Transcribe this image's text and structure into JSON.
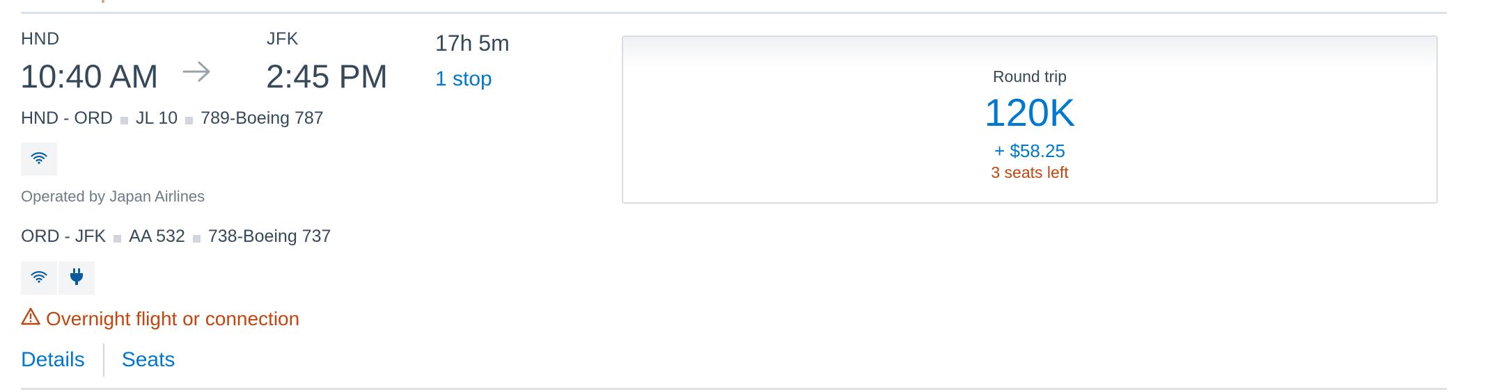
{
  "flight": {
    "depart": {
      "code": "HND",
      "time": "10:40 AM"
    },
    "arrive": {
      "code": "JFK",
      "time": "2:45 PM"
    },
    "arrow_icon": "arrow-right-icon",
    "duration": "17h 5m",
    "stops": "1 stop",
    "segments": [
      {
        "route": "HND - ORD",
        "flight_number": "JL 10",
        "aircraft": "789-Boeing 787",
        "amenities": [
          "wifi-icon"
        ],
        "operated_by": "Operated by Japan Airlines"
      },
      {
        "route": "ORD - JFK",
        "flight_number": "AA 532",
        "aircraft": "738-Boeing 737",
        "amenities": [
          "wifi-icon",
          "power-outlet-icon"
        ]
      }
    ],
    "warning": {
      "icon": "warning-triangle-icon",
      "text": "Overnight flight or connection"
    },
    "links": {
      "details": "Details",
      "seats": "Seats"
    }
  },
  "fare": {
    "label": "Round trip",
    "miles": "120K",
    "taxes": "+ $58.25",
    "seats_left": "3 seats left"
  },
  "colors": {
    "link_blue": "#0078d2",
    "warning_orange": "#c4450e",
    "text_dark": "#36495a",
    "text_muted": "#6e7b86"
  }
}
